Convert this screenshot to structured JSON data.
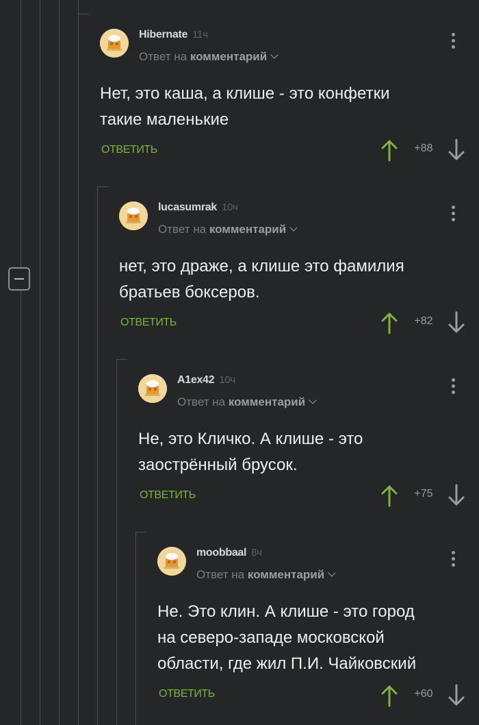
{
  "reply_prefix": "Ответ на",
  "reply_target": "комментарий",
  "reply_label": "ОТВЕТИТЬ",
  "colors": {
    "background": "#242628",
    "thread_line": "#4a4d51",
    "upvote_green": "#7cb342",
    "text": "#eceef0",
    "muted": "#7a7d81"
  },
  "icons": {
    "collapse": "minus-square-icon",
    "menu": "more-vertical-icon",
    "upvote": "arrow-up-icon",
    "downvote": "arrow-down-icon",
    "chevron": "chevron-down-icon"
  },
  "comments": [
    {
      "author": "Hibernate",
      "time": "11ч",
      "text": "Нет, это каша, а клише - это конфетки\nтакие маленькие",
      "rating": "+88"
    },
    {
      "author": "lucasumrak",
      "time": "10ч",
      "text": "нет, это драже, а клише это фамилия\nбратьев боксеров.",
      "rating": "+82"
    },
    {
      "author": "A1ex42",
      "time": "10ч",
      "text": "Не, это Кличко. А клише - это\nзаострённый брусок.",
      "rating": "+75"
    },
    {
      "author": "moobbaal",
      "time": "8ч",
      "text": "Не. Это клин. А клише - это город\nна северо-западе московской\nобласти, где жил П.И. Чайковский",
      "rating": "+60"
    }
  ]
}
